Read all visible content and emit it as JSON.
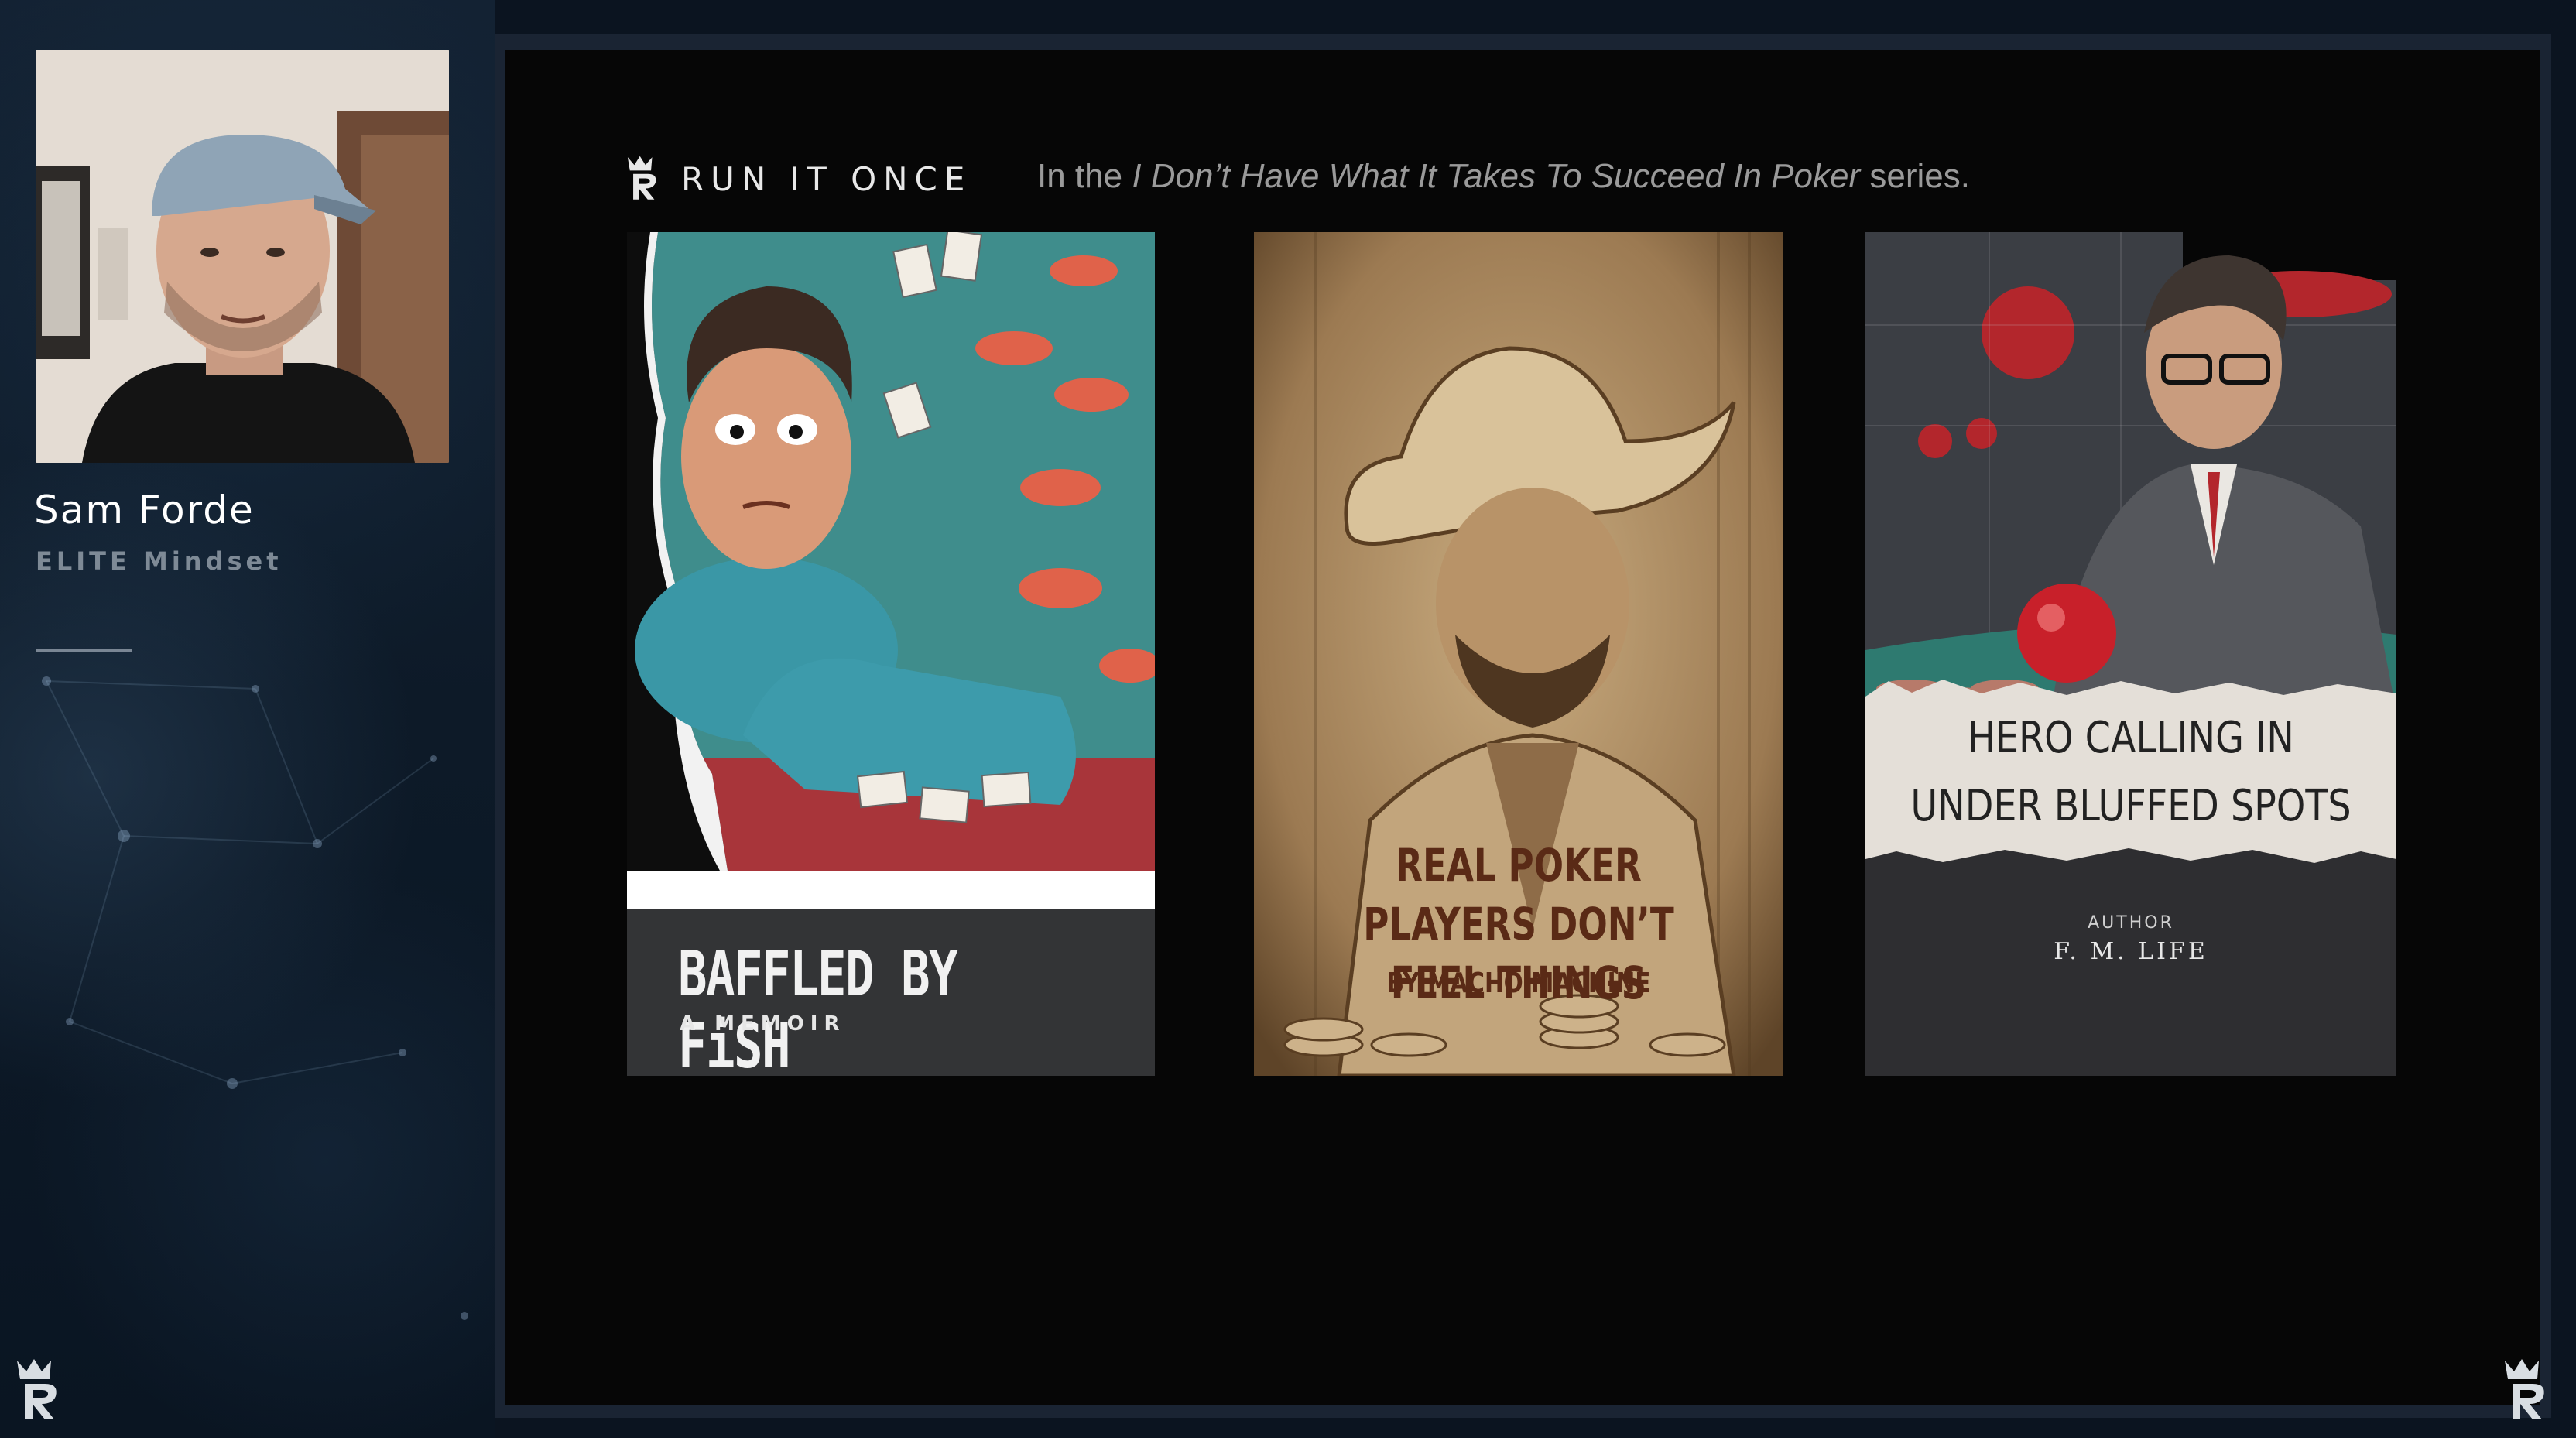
{
  "presenter": {
    "name": "Sam Forde",
    "role": "ELITE Mindset"
  },
  "slide": {
    "brand": "RUN IT ONCE",
    "series_prefix": "In the",
    "series_title": "I Don’t Have What It Takes To Succeed In Poker",
    "series_suffix": "series."
  },
  "books": [
    {
      "title": "BAFFLED BY FiSH",
      "subtitle": "A MEMOIR"
    },
    {
      "title_line1": "REAL POKER PLAYERS DON’T",
      "title_line2": "FEEL THINGS",
      "byline": "BY MACHO MACHINE"
    },
    {
      "title_line1": "HERO CALLING IN",
      "title_line2": "UNDER BLUFFED SPOTS",
      "author_label": "AUTHOR",
      "author": "F. M. LIFE"
    }
  ],
  "icons": [
    "crown-r-logo-icon"
  ],
  "colors": {
    "slide_bg": "#060606",
    "sidebar_bg": "#0d1a28",
    "accent_red": "#c8202a"
  }
}
